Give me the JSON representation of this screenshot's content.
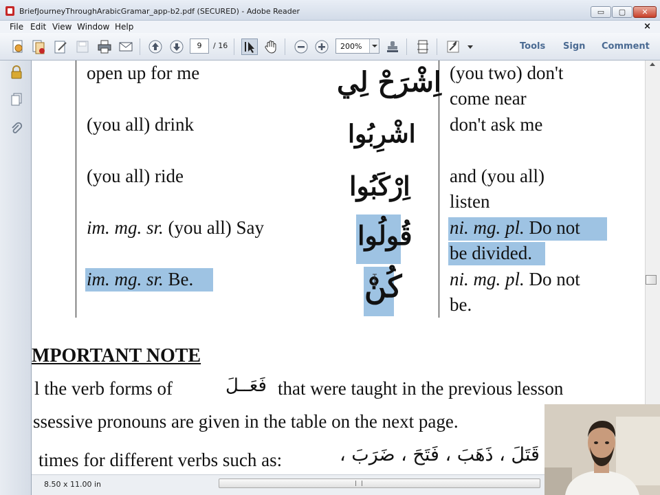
{
  "window": {
    "title": "BriefJourneyThroughArabicGramar_app-b2.pdf (SECURED) - Adobe Reader",
    "minimize_label": "▭",
    "maximize_label": "▢",
    "close_label": "✕"
  },
  "menu": {
    "items": [
      "File",
      "Edit",
      "View",
      "Window",
      "Help"
    ],
    "close_document": "×"
  },
  "toolbar": {
    "current_page": "9",
    "total_pages": "/ 16",
    "zoom": "200%",
    "tools_label": "Tools",
    "sign_label": "Sign",
    "comment_label": "Comment"
  },
  "document": {
    "rows": [
      {
        "english": "open up for me",
        "arabic": "اِشْرَحْ لِي",
        "right": [
          "(you two) don't",
          "come near"
        ]
      },
      {
        "english": "(you all) drink",
        "arabic": "اشْرِبُوا",
        "right": [
          "don't ask me"
        ]
      },
      {
        "english": "(you all) ride",
        "arabic": "اِرْكَبُوا",
        "right": [
          "and (you all)",
          "listen"
        ]
      },
      {
        "english_prefix": "im. mg. sr.",
        "english": " (you all)  Say",
        "arabic": "قُولُوا",
        "right_prefix": "ni. mg. pl.",
        "right": [
          "  Do not",
          "be divided."
        ]
      },
      {
        "english_prefix": "im. mg. sr.",
        "english": " Be.",
        "arabic": "كُنْ",
        "right_prefix": "ni. mg. pl.",
        "right": [
          "  Do not",
          "be."
        ]
      }
    ],
    "heading": "MPORTANT NOTE",
    "para_line1_a": "l  the  verb  forms  of",
    "para_line1_ar": "فَعَــلَ",
    "para_line1_b": "that  were  taught  in  the   previous lesson",
    "para_line2": "ssessive  pronouns  are  given in the table on the next page.",
    "para_line3": "times for different verbs such as:",
    "para_line3_ar": "قَتَلَ ، ذَهَبَ ، فَتَحَ ، ضَرَبَ ،"
  },
  "status": {
    "page_size": "8.50 x 11.00 in"
  },
  "colors": {
    "highlight": "#9ec3e3",
    "link_text": "#4a6a92"
  }
}
